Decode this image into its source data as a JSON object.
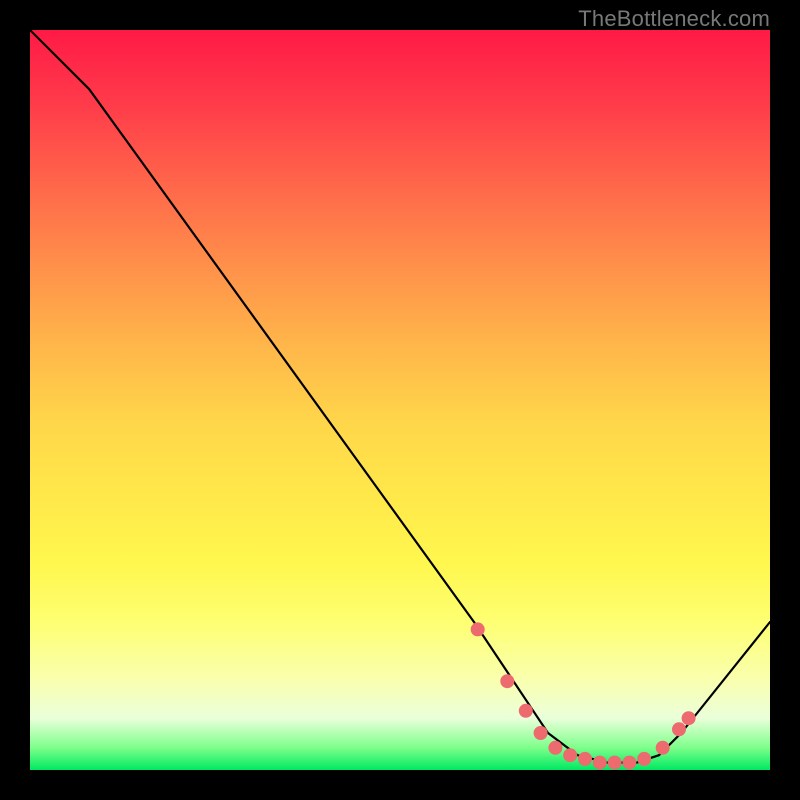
{
  "attribution": "TheBottleneck.com",
  "colors": {
    "curve_stroke": "#000000",
    "marker_fill": "#ed6a6f",
    "marker_stroke": "#ed6a6f"
  },
  "chart_data": {
    "type": "line",
    "title": "",
    "xlabel": "",
    "ylabel": "",
    "xlim": [
      0,
      100
    ],
    "ylim": [
      0,
      100
    ],
    "grid": false,
    "series": [
      {
        "name": "curve",
        "x": [
          0,
          8,
          60,
          64,
          68,
          70,
          74,
          78,
          82,
          85,
          88,
          100
        ],
        "y": [
          100,
          92,
          20,
          14,
          8,
          5,
          2,
          1,
          1,
          2,
          5,
          20
        ]
      }
    ],
    "markers": {
      "name": "highlight-points",
      "x": [
        60.5,
        64.5,
        67,
        69,
        71,
        73,
        75,
        77,
        79,
        81,
        83,
        85.5,
        87.7,
        89
      ],
      "y": [
        19,
        12,
        8,
        5,
        3,
        2,
        1.5,
        1,
        1,
        1,
        1.5,
        3,
        5.5,
        7
      ]
    }
  }
}
